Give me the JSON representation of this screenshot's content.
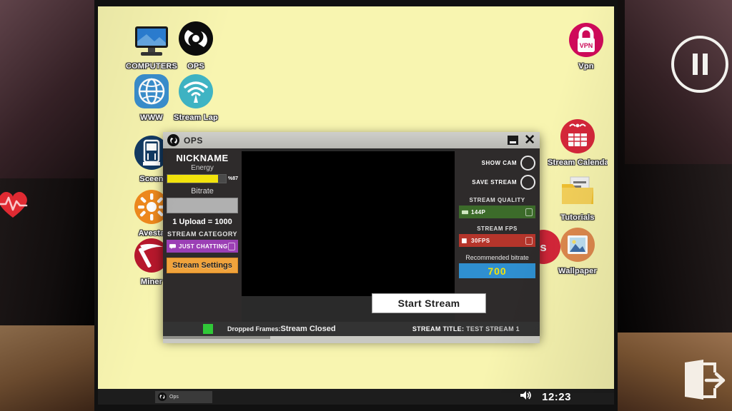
{
  "desktop": {
    "icons": [
      {
        "name": "computers",
        "label": "COMPUTERS",
        "type": "monitor"
      },
      {
        "name": "ops",
        "label": "OPS",
        "type": "obs-logo"
      },
      {
        "name": "www",
        "label": "WWW",
        "type": "globe"
      },
      {
        "name": "stream-lap",
        "label": "Stream Lap",
        "type": "wifi"
      },
      {
        "name": "screen",
        "label": "Sceen",
        "type": "arcade"
      },
      {
        "name": "avesta",
        "label": "Avesta",
        "type": "sun"
      },
      {
        "name": "miner",
        "label": "Miner",
        "type": "pickaxe"
      },
      {
        "name": "vpn",
        "label": "Vpn",
        "type": "lock",
        "badge": "VPN"
      },
      {
        "name": "stream-calendar",
        "label": "Stream Calendar",
        "type": "calendar"
      },
      {
        "name": "tutorials",
        "label": "Tutorials",
        "type": "folder"
      },
      {
        "name": "wallpaper",
        "label": "Wallpaper",
        "type": "image"
      }
    ]
  },
  "window": {
    "title": "OPS",
    "icon": "obs-logo-icon",
    "minimize_label": "",
    "close_label": "✕",
    "left_panel": {
      "nickname_label": "NICKNAME",
      "nickname_value": "Energy",
      "energy_percent": 87,
      "energy_percent_text": "%87",
      "bitrate_label": "Bitrate",
      "bitrate_value": "",
      "upload_ratio": "1 Upload = 1000",
      "category_label": "STREAM CATEGORY",
      "category_value": "JUST CHATTING",
      "stream_settings_label": "Stream Settings"
    },
    "right_panel": {
      "show_cam_label": "SHOW CAM",
      "show_cam_on": false,
      "save_stream_label": "SAVE STREAM",
      "save_stream_on": false,
      "quality_label": "STREAM QUALITY",
      "quality_value": "144P",
      "fps_label": "STREAM FPS",
      "fps_value": "30FPS",
      "recommended_label": "Recommended bitrate",
      "recommended_value": "700"
    },
    "start_button": "Start Stream",
    "status": {
      "dropped_frames_label": "Dropped Frames:",
      "dropped_frames_value": "Stream Closed",
      "stream_title_label": "STREAM TITLE:",
      "stream_title_value": "TEST STREAM 1",
      "indicator_color": "#30c838"
    }
  },
  "taskbar": {
    "app_label": "Ops",
    "clock": "12:23",
    "volume_icon": "speaker-icon"
  },
  "overlay": {
    "pause_label": "pause-icon",
    "exit_label": "exit-icon",
    "health_label": "heart-icon"
  },
  "colors": {
    "desktop_bg": "#f8f5b0",
    "accent_orange": "#f0a33c",
    "accent_purple": "#9b3fb5",
    "accent_green": "#3c6b2a",
    "accent_red": "#b5352b",
    "accent_blue": "#2f8fd0",
    "energy_yellow": "#f2e30c"
  }
}
